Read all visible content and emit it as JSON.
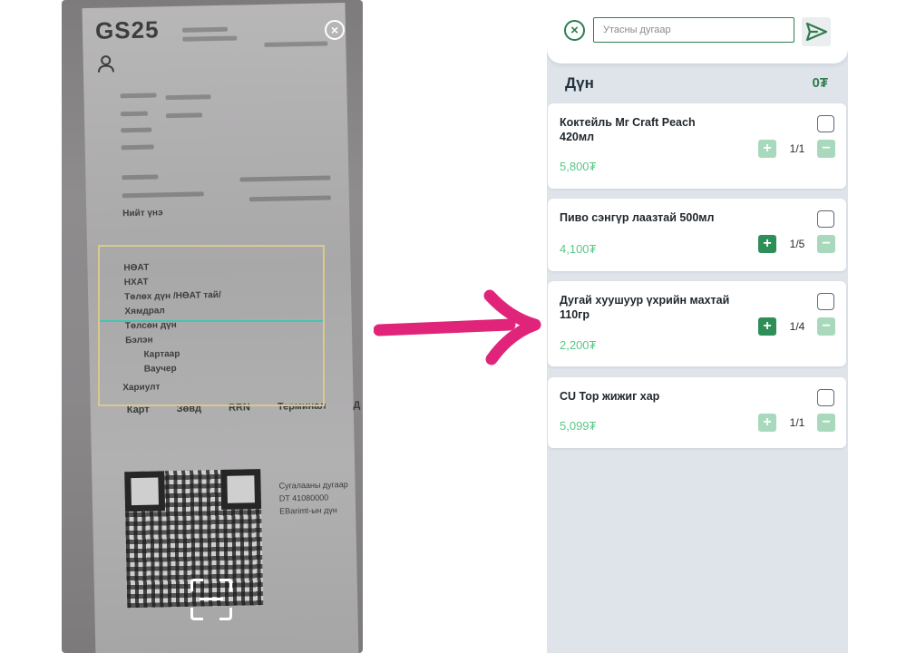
{
  "scan_screen": {
    "receipt_brand": "GS25",
    "receipt_cols": [
      "Карт",
      "Зөвд",
      "RRN",
      "Терминал",
      "Д"
    ],
    "receipt_lines": [
      "Нийт үнэ",
      "НӨАТ",
      "НХАТ",
      "Төлөх дүн /НӨАТ тай/",
      "Хямдрал",
      "Төлсөн дүн",
      "Бэлэн",
      "Картаар",
      "Ваучер",
      "Хариулт"
    ],
    "receipt_qr_text": [
      "Сугалааны дугаар",
      "DT 41080000",
      "EBarimt-ын дүн"
    ],
    "close_icon": "×"
  },
  "app": {
    "close_icon": "×",
    "phone_placeholder": "Утасны дугаар",
    "phone_value": "",
    "send_icon": "send-icon",
    "total_label": "Дүн",
    "total_value": "0₮",
    "accent_color": "#2e7d4f",
    "items": [
      {
        "name": "Коктейль Mr Craft Peach 420мл",
        "price": "5,800₮",
        "qty": "1/1",
        "plus_enabled": false,
        "checked": false
      },
      {
        "name": "Пиво сэнгүр лаазтай 500мл",
        "price": "4,100₮",
        "qty": "1/5",
        "plus_enabled": true,
        "checked": false
      },
      {
        "name": "Дугай хуушуур үхрийн махтай 110гр",
        "price": "2,200₮",
        "qty": "1/4",
        "plus_enabled": true,
        "checked": false
      },
      {
        "name": "CU Top жижиг хар",
        "price": "5,099₮",
        "qty": "1/1",
        "plus_enabled": false,
        "checked": false
      }
    ]
  },
  "arrow_color": "#e0247a"
}
